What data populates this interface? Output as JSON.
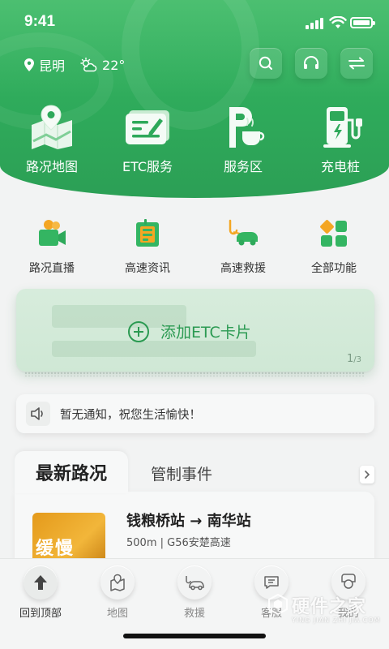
{
  "status_bar": {
    "time": "9:41"
  },
  "header": {
    "city": "昆明",
    "temperature": "22°",
    "actions": [
      {
        "name": "search-icon"
      },
      {
        "name": "headset-icon"
      },
      {
        "name": "switch-icon"
      }
    ]
  },
  "quick_entries": [
    {
      "label": "路况地图",
      "icon": "map-icon"
    },
    {
      "label": "ETC服务",
      "icon": "etc-card-icon"
    },
    {
      "label": "服务区",
      "icon": "service-area-icon"
    },
    {
      "label": "充电桩",
      "icon": "charging-pile-icon"
    }
  ],
  "functions": [
    {
      "label": "路况直播",
      "icon": "video-camera-icon"
    },
    {
      "label": "高速资讯",
      "icon": "news-icon"
    },
    {
      "label": "高速救援",
      "icon": "tow-truck-icon"
    },
    {
      "label": "全部功能",
      "icon": "grid-icon"
    }
  ],
  "etc_card": {
    "add_label": "添加ETC卡片",
    "page_current": "1",
    "page_total": "/3"
  },
  "notice": {
    "text": "暂无通知，祝您生活愉快！"
  },
  "tabs": {
    "active": "最新路况",
    "other": "管制事件"
  },
  "news": {
    "thumb_tag": "缓慢",
    "title": "钱粮桥站 → 南华站",
    "subtitle": "500m | G56安楚高速"
  },
  "bottom_nav": [
    {
      "label": "回到顶部",
      "icon": "arrow-up-icon"
    },
    {
      "label": "地图",
      "icon": "map-icon"
    },
    {
      "label": "救援",
      "icon": "rescue-icon"
    },
    {
      "label": "客服",
      "icon": "chat-icon"
    },
    {
      "label": "我的",
      "icon": "profile-icon"
    }
  ],
  "watermark": {
    "name": "硬件之家",
    "sub": "YING JIAN ZHI JIA.COM"
  },
  "colors": {
    "brand_green": "#2ea95a",
    "accent_orange": "#f4a623"
  }
}
